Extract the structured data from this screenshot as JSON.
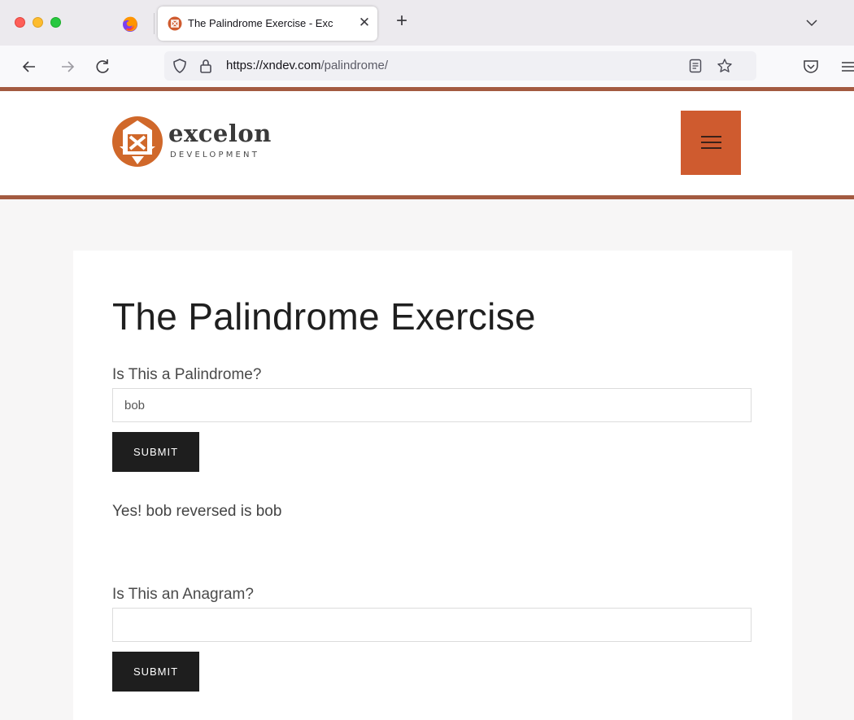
{
  "browser": {
    "tab": {
      "title": "The Palindrome Exercise - Exc"
    },
    "url": {
      "host": "https://xndev.com",
      "path": "/palindrome/"
    },
    "icons": [
      "firefox-icon",
      "close-icon",
      "plus-icon",
      "chevron-down-icon",
      "back-icon",
      "forward-icon",
      "reload-icon",
      "shield-icon",
      "lock-icon",
      "reader-view-icon",
      "star-icon",
      "pocket-icon",
      "hamburger-menu-icon"
    ]
  },
  "site": {
    "logo": {
      "name": "excelon",
      "tagline": "DEVELOPMENT"
    },
    "brand_color": "#cf5b2f",
    "accent_line_color": "#a35a40"
  },
  "main": {
    "title": "The Palindrome Exercise",
    "palindrome": {
      "label": "Is This a Palindrome?",
      "value": "bob",
      "submit_label": "SUBMIT",
      "result": "Yes! bob reversed is bob"
    },
    "anagram": {
      "label": "Is This an Anagram?",
      "value": "",
      "submit_label": "SUBMIT"
    }
  }
}
